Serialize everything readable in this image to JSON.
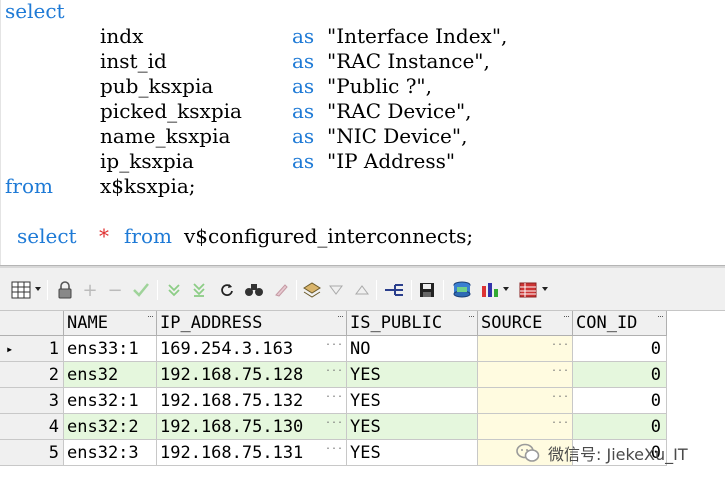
{
  "editor": {
    "lines": [
      {
        "keyword": "select"
      },
      {
        "column": "indx",
        "as": "as",
        "alias": "\"Interface Index\","
      },
      {
        "column": "inst_id",
        "as": "as",
        "alias": "\"RAC Instance\","
      },
      {
        "column": "pub_ksxpia",
        "as": "as",
        "alias": "\"Public ?\","
      },
      {
        "column": "picked_ksxpia",
        "as": "as",
        "alias": "\"RAC Device\","
      },
      {
        "column": "name_ksxpia",
        "as": "as",
        "alias": "\"NIC Device\","
      },
      {
        "column": "ip_ksxpia",
        "as": "as",
        "alias": "\"IP Address\""
      },
      {
        "keyword": "from",
        "table": "x$ksxpia;"
      }
    ],
    "query2": {
      "select_kw": "select",
      "star": "*",
      "from_kw": "from",
      "table": "v$configured_interconnects;"
    }
  },
  "toolbar": {
    "icons": [
      "grid-view-icon",
      "lock-icon",
      "add-record-icon",
      "delete-record-icon",
      "post-edit-icon",
      "next-page-icon",
      "last-page-icon",
      "refresh-icon",
      "find-icon",
      "clear-icon",
      "export-icon",
      "filter-down-icon",
      "filter-up-icon",
      "query-plan-icon",
      "save-icon",
      "database-icon",
      "chart-icon",
      "table-layout-icon"
    ]
  },
  "grid": {
    "columns": [
      "NAME",
      "IP_ADDRESS",
      "IS_PUBLIC",
      "SOURCE",
      "CON_ID"
    ],
    "rows": [
      {
        "n": "1",
        "name": "ens33:1",
        "ip": "169.254.3.163",
        "pub": "NO",
        "source": "",
        "con_id": "0"
      },
      {
        "n": "2",
        "name": "ens32",
        "ip": "192.168.75.128",
        "pub": "YES",
        "source": "",
        "con_id": "0"
      },
      {
        "n": "3",
        "name": "ens32:1",
        "ip": "192.168.75.132",
        "pub": "YES",
        "source": "",
        "con_id": "0"
      },
      {
        "n": "4",
        "name": "ens32:2",
        "ip": "192.168.75.130",
        "pub": "YES",
        "source": "",
        "con_id": "0"
      },
      {
        "n": "5",
        "name": "ens32:3",
        "ip": "192.168.75.131",
        "pub": "YES",
        "source": "",
        "con_id": "0"
      }
    ],
    "current_row_marker": "▸",
    "ellipsis": "..."
  },
  "watermark": {
    "text": "微信号: JiekeXu_IT"
  },
  "colors": {
    "keyword": "#1e7ad6",
    "highlight_row": "#e5f7dd",
    "source_cell": "#fffbe0",
    "grid_header": "#f0f0f0"
  }
}
